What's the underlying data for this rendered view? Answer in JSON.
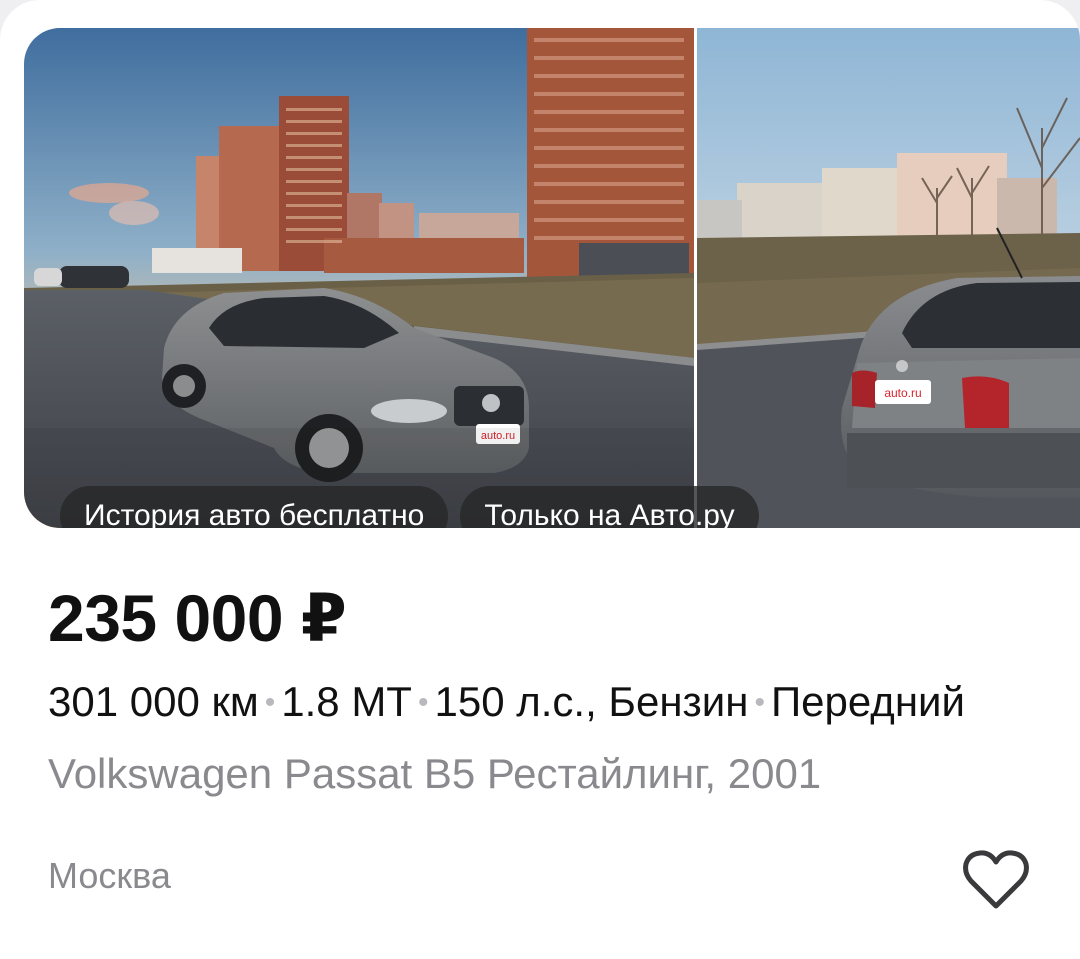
{
  "listing": {
    "badges": [
      "История авто бесплатно",
      "Только на Авто.ру"
    ],
    "price": "235 000 ₽",
    "specs": {
      "mileage": "301 000 км",
      "engine": "1.8 MT",
      "power_fuel": "150 л.с., Бензин",
      "drive": "Передний",
      "separator": "•"
    },
    "model": "Volkswagen Passat B5 Рестайлинг, 2001",
    "city": "Москва",
    "plate_text": "auto.ru",
    "favorite_icon": "heart-outline-icon"
  }
}
